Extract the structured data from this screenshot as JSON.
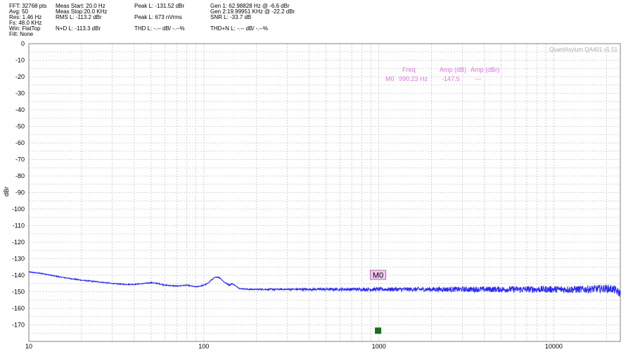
{
  "header": {
    "col1": [
      "FFT: 32768 pts",
      "Avg: 50",
      "Res: 1.46 Hz",
      "Fs: 48.0 KHz",
      "Win: FlatTop",
      "Filt: None"
    ],
    "col2": [
      "Meas Start: 20.0 Hz",
      "Meas Stop:20.0 KHz",
      "RMS L: -113.2 dBr",
      "",
      "N+D L: -113.3 dBr"
    ],
    "col3": [
      "Peak L: -131.52 dBr",
      "",
      "Peak L: 673 nVrms",
      "",
      "THD L: -.-- dB/ -.--%"
    ],
    "col4": [
      "Gen 1: 62.98828 Hz @ -6.6  dBr",
      "Gen 2:19.99951 KHz @ -22.2  dBr",
      "SNR L: -33.7 dB",
      "",
      "THD+N L: -.-- dB/ -.--%"
    ]
  },
  "brand_text": "QuantAsylum QA401 v1.51",
  "marker_table": {
    "headers": [
      "Freq",
      "Amp (dB)",
      "Amp (dBr)"
    ],
    "row": [
      "M0",
      "990.23 Hz",
      "-147.5",
      "---"
    ]
  },
  "marker_label": "M0",
  "colors": {
    "trace": "#2a2aee",
    "grid": "#c8c8c8",
    "annotation": "#e070e0",
    "marker_box": "#f3c9f3",
    "marker_square": "#1e6b1e"
  },
  "chart_data": {
    "type": "line",
    "x_scale": "log",
    "xlim": [
      10,
      24000
    ],
    "ylim": [
      -180,
      0
    ],
    "x_ticks": [
      10,
      100,
      1000,
      10000
    ],
    "x_tick_labels": [
      "10",
      "100",
      "1000",
      "10000"
    ],
    "y_ticks": [
      0,
      -10,
      -20,
      -30,
      -40,
      -50,
      -60,
      -70,
      -80,
      -90,
      -100,
      -110,
      -120,
      -130,
      -140,
      -150,
      -160,
      -170
    ],
    "ylabel": "dBr",
    "xlabel": "",
    "grid": true,
    "series": [
      {
        "x": [
          10,
          12,
          15,
          20,
          25,
          30,
          35,
          40,
          45,
          50,
          55,
          60,
          70,
          80,
          90,
          100,
          105,
          110,
          115,
          120,
          125,
          130,
          140,
          145,
          150,
          155,
          160,
          180,
          200,
          250,
          300,
          400,
          500,
          700,
          1000,
          1500,
          2000,
          3000,
          5000,
          7000,
          10000,
          15000,
          20000,
          22000,
          24000
        ],
        "y": [
          -138,
          -139,
          -141,
          -143,
          -144,
          -145,
          -145.5,
          -145.5,
          -145,
          -144.5,
          -145,
          -146,
          -146.5,
          -146,
          -147,
          -146,
          -145,
          -143,
          -141.5,
          -141,
          -142,
          -144,
          -146,
          -145,
          -146,
          -147,
          -148,
          -148.5,
          -148.5,
          -148.5,
          -148.5,
          -148.5,
          -148.5,
          -148.5,
          -148.5,
          -148.5,
          -148.5,
          -148.5,
          -148.5,
          -148.5,
          -148.5,
          -148.5,
          -148,
          -148.5,
          -151
        ]
      }
    ],
    "markers": [
      {
        "name": "M0",
        "x": 990.23,
        "y": -147.5
      }
    ]
  }
}
